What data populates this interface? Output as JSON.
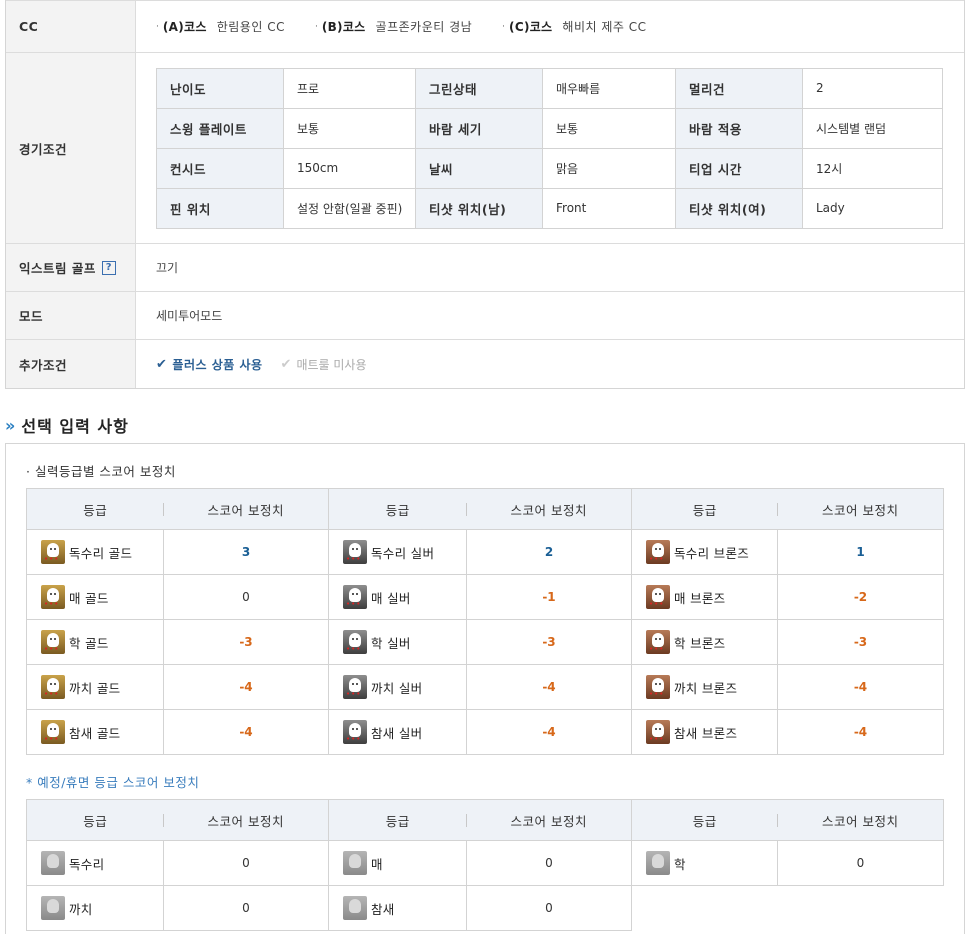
{
  "info": {
    "cc": {
      "label": "CC",
      "courses": [
        {
          "code": "(A)코스",
          "name": "한림용인 CC"
        },
        {
          "code": "(B)코스",
          "name": "골프존카운티 경남"
        },
        {
          "code": "(C)코스",
          "name": "해비치 제주 CC"
        }
      ]
    },
    "conditions": {
      "label": "경기조건",
      "rows": [
        [
          {
            "h": "난이도",
            "v": "프로"
          },
          {
            "h": "그린상태",
            "v": "매우빠름"
          },
          {
            "h": "멀리건",
            "v": "2"
          }
        ],
        [
          {
            "h": "스윙 플레이트",
            "v": "보통"
          },
          {
            "h": "바람 세기",
            "v": "보통"
          },
          {
            "h": "바람 적용",
            "v": "시스템별 랜덤"
          }
        ],
        [
          {
            "h": "컨시드",
            "v": "150cm"
          },
          {
            "h": "날씨",
            "v": "맑음"
          },
          {
            "h": "티업 시간",
            "v": "12시"
          }
        ],
        [
          {
            "h": "핀 위치",
            "v": "설정 안함(일괄 중핀)"
          },
          {
            "h": "티샷 위치(남)",
            "v": "Front"
          },
          {
            "h": "티샷 위치(여)",
            "v": "Lady"
          }
        ]
      ]
    },
    "extreme": {
      "label": "익스트림 골프",
      "help": "?",
      "value": "끄기"
    },
    "mode": {
      "label": "모드",
      "value": "세미투어모드"
    },
    "extra": {
      "label": "추가조건",
      "plus": "플러스 상품 사용",
      "mat": "매트룰 미사용"
    }
  },
  "section": {
    "arrow": "»",
    "title": "선택 입력 사항"
  },
  "score": {
    "subtitle": "· 실력등급별 스코어 보정치",
    "headers": {
      "grade": "등급",
      "score": "스코어 보정치"
    },
    "rows": [
      [
        {
          "name": "독수리 골드",
          "score": "3"
        },
        {
          "name": "독수리 실버",
          "score": "2"
        },
        {
          "name": "독수리 브론즈",
          "score": "1"
        }
      ],
      [
        {
          "name": "매 골드",
          "score": "0"
        },
        {
          "name": "매 실버",
          "score": "-1"
        },
        {
          "name": "매 브론즈",
          "score": "-2"
        }
      ],
      [
        {
          "name": "학 골드",
          "score": "-3"
        },
        {
          "name": "학 실버",
          "score": "-3"
        },
        {
          "name": "학 브론즈",
          "score": "-3"
        }
      ],
      [
        {
          "name": "까치 골드",
          "score": "-4"
        },
        {
          "name": "까치 실버",
          "score": "-4"
        },
        {
          "name": "까치 브론즈",
          "score": "-4"
        }
      ],
      [
        {
          "name": "참새 골드",
          "score": "-4"
        },
        {
          "name": "참새 실버",
          "score": "-4"
        },
        {
          "name": "참새 브론즈",
          "score": "-4"
        }
      ]
    ]
  },
  "reserve": {
    "subtitle": "* 예정/휴면 등급 스코어 보정치",
    "rows": [
      [
        {
          "name": "독수리",
          "score": "0"
        },
        {
          "name": "매",
          "score": "0"
        },
        {
          "name": "학",
          "score": "0"
        }
      ],
      [
        {
          "name": "까치",
          "score": "0"
        },
        {
          "name": "참새",
          "score": "0"
        }
      ]
    ]
  },
  "colors": {
    "positive": "#1a5f95",
    "negative": "#d7681a",
    "accent": "#2a7fc1"
  }
}
